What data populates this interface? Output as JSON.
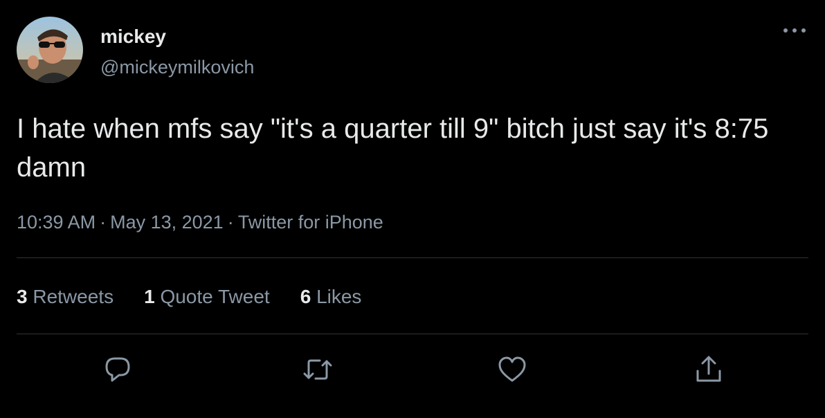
{
  "user": {
    "display_name": "mickey",
    "handle": "@mickeymilkovich"
  },
  "tweet": {
    "text": "I hate when mfs say \"it's a quarter till 9\" bitch just say it's 8:75 damn",
    "time": "10:39 AM",
    "separator": "·",
    "date": "May 13, 2021",
    "source": "Twitter for iPhone"
  },
  "stats": {
    "retweets": {
      "count": "3",
      "label": "Retweets"
    },
    "quotes": {
      "count": "1",
      "label": "Quote Tweet"
    },
    "likes": {
      "count": "6",
      "label": "Likes"
    }
  },
  "icons": {
    "more": "more-horizontal-icon",
    "reply": "reply-icon",
    "retweet": "retweet-icon",
    "like": "heart-icon",
    "share": "share-icon"
  },
  "colors": {
    "background": "#000000",
    "primary_text": "#e7e9ea",
    "secondary_text": "#8b98a5",
    "divider": "#2f3336"
  }
}
